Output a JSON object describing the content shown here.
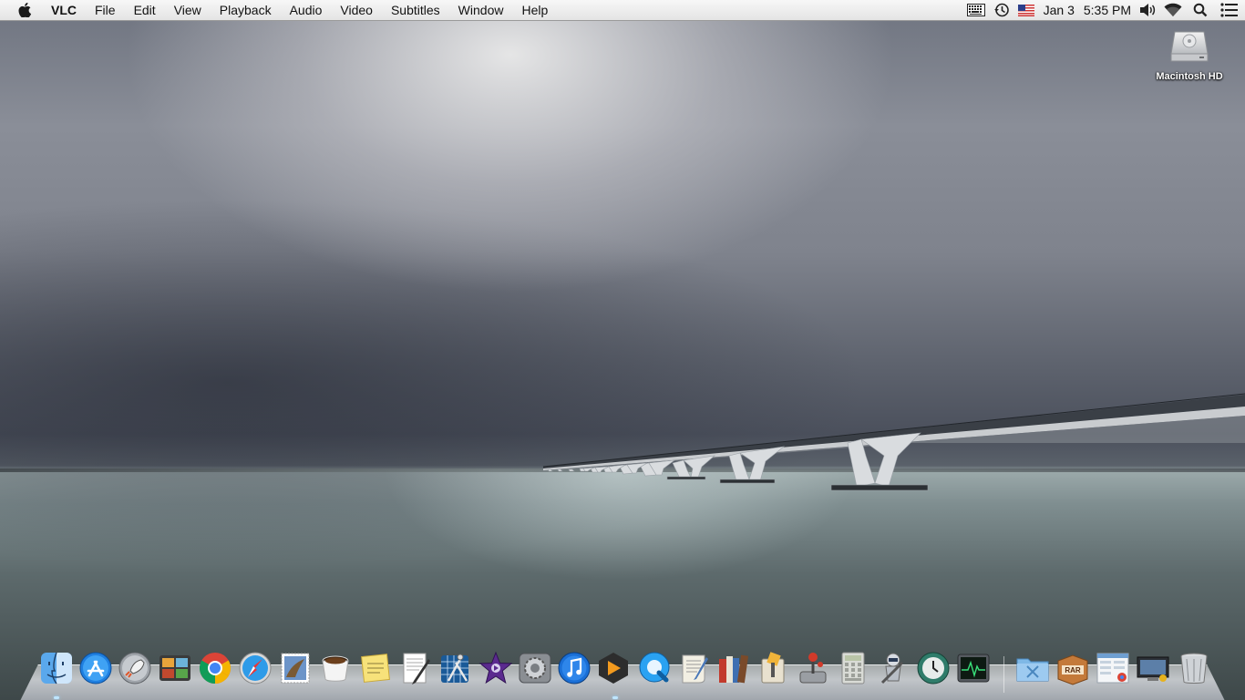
{
  "menubar": {
    "apple_icon": "apple-logo-icon",
    "app_name": "VLC",
    "menus": [
      "File",
      "Edit",
      "View",
      "Playback",
      "Audio",
      "Video",
      "Subtitles",
      "Window",
      "Help"
    ],
    "status": {
      "date": "Jan 3",
      "time": "5:35 PM",
      "icons": [
        "keyboard-viewer-icon",
        "time-machine-icon",
        "us-flag-input-icon",
        "volume-icon",
        "wifi-icon",
        "spotlight-search-icon",
        "notification-center-icon"
      ]
    }
  },
  "desktop": {
    "icons": [
      {
        "label": "Macintosh HD",
        "icon": "hard-drive-icon"
      }
    ]
  },
  "dock": {
    "apps": [
      {
        "name": "Finder",
        "icon": "finder-icon"
      },
      {
        "name": "App Store",
        "icon": "app-store-icon"
      },
      {
        "name": "Launchpad",
        "icon": "launchpad-rocket-icon"
      },
      {
        "name": "Photo Booth",
        "icon": "photo-app-icon"
      },
      {
        "name": "Google Chrome",
        "icon": "chrome-icon"
      },
      {
        "name": "Safari",
        "icon": "safari-compass-icon"
      },
      {
        "name": "Mail",
        "icon": "mail-stamp-icon"
      },
      {
        "name": "Coffee",
        "icon": "coffee-cup-icon"
      },
      {
        "name": "Stickies",
        "icon": "stickies-notes-icon"
      },
      {
        "name": "TextEdit",
        "icon": "textedit-pen-icon"
      },
      {
        "name": "Xcode",
        "icon": "xcode-compass-icon"
      },
      {
        "name": "iMovie",
        "icon": "imovie-star-icon"
      },
      {
        "name": "System Preferences",
        "icon": "system-preferences-gear-icon"
      },
      {
        "name": "iTunes",
        "icon": "itunes-note-icon"
      },
      {
        "name": "Infuse",
        "icon": "media-player-play-icon"
      },
      {
        "name": "QuickTime Player",
        "icon": "quicktime-icon"
      },
      {
        "name": "Script Editor",
        "icon": "script-editor-icon"
      },
      {
        "name": "iBooks",
        "icon": "books-icon"
      },
      {
        "name": "Archive Utility",
        "icon": "archive-icon"
      },
      {
        "name": "Font Book",
        "icon": "joystick-app-icon"
      },
      {
        "name": "Calculator",
        "icon": "calculator-icon"
      },
      {
        "name": "Automator",
        "icon": "automator-robot-icon"
      },
      {
        "name": "Time Machine",
        "icon": "time-machine-clock-icon"
      },
      {
        "name": "Activity Monitor",
        "icon": "activity-monitor-icon"
      }
    ],
    "others": [
      {
        "name": "Utilities",
        "icon": "utilities-folder-icon"
      },
      {
        "name": "RAR",
        "icon": "rar-box-icon",
        "text": "RAR"
      },
      {
        "name": "Documents",
        "icon": "documents-stack-icon"
      },
      {
        "name": "Screen Sharing",
        "icon": "screen-sharing-icon"
      },
      {
        "name": "Trash",
        "icon": "trash-icon"
      }
    ]
  },
  "colors": {
    "menubar_bg": "#ececec",
    "itunes_blue": "#1a6fd6",
    "chrome_red": "#db4437",
    "chrome_yellow": "#f4b400",
    "chrome_green": "#0f9d58",
    "chrome_blue": "#4285f4"
  }
}
